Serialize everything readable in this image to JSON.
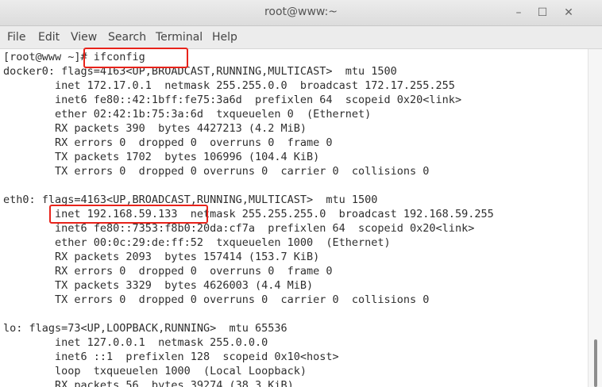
{
  "window": {
    "title": "root@www:~",
    "min_icon": "–",
    "max_icon": "☐",
    "close_icon": "✕"
  },
  "menu": [
    "File",
    "Edit",
    "View",
    "Search",
    "Terminal",
    "Help"
  ],
  "terminal": {
    "lines": [
      "[root@www ~]# ifconfig",
      "docker0: flags=4163<UP,BROADCAST,RUNNING,MULTICAST>  mtu 1500",
      "        inet 172.17.0.1  netmask 255.255.0.0  broadcast 172.17.255.255",
      "        inet6 fe80::42:1bff:fe75:3a6d  prefixlen 64  scopeid 0x20<link>",
      "        ether 02:42:1b:75:3a:6d  txqueuelen 0  (Ethernet)",
      "        RX packets 390  bytes 4427213 (4.2 MiB)",
      "        RX errors 0  dropped 0  overruns 0  frame 0",
      "        TX packets 1702  bytes 106996 (104.4 KiB)",
      "        TX errors 0  dropped 0 overruns 0  carrier 0  collisions 0",
      "",
      "eth0: flags=4163<UP,BROADCAST,RUNNING,MULTICAST>  mtu 1500",
      "        inet 192.168.59.133  netmask 255.255.255.0  broadcast 192.168.59.255",
      "        inet6 fe80::7353:f8b0:20da:cf7a  prefixlen 64  scopeid 0x20<link>",
      "        ether 00:0c:29:de:ff:52  txqueuelen 1000  (Ethernet)",
      "        RX packets 2093  bytes 157414 (153.7 KiB)",
      "        RX errors 0  dropped 0  overruns 0  frame 0",
      "        TX packets 3329  bytes 4626003 (4.4 MiB)",
      "        TX errors 0  dropped 0 overruns 0  carrier 0  collisions 0",
      "",
      "lo: flags=73<UP,LOOPBACK,RUNNING>  mtu 65536",
      "        inet 127.0.0.1  netmask 255.0.0.0",
      "        inet6 ::1  prefixlen 128  scopeid 0x10<host>",
      "        loop  txqueuelen 1000  (Local Loopback)",
      "        RX packets 56  bytes 39274 (38.3 KiB)"
    ]
  },
  "colors": {
    "highlight": "#e8231b",
    "text": "#2e2e2e"
  }
}
